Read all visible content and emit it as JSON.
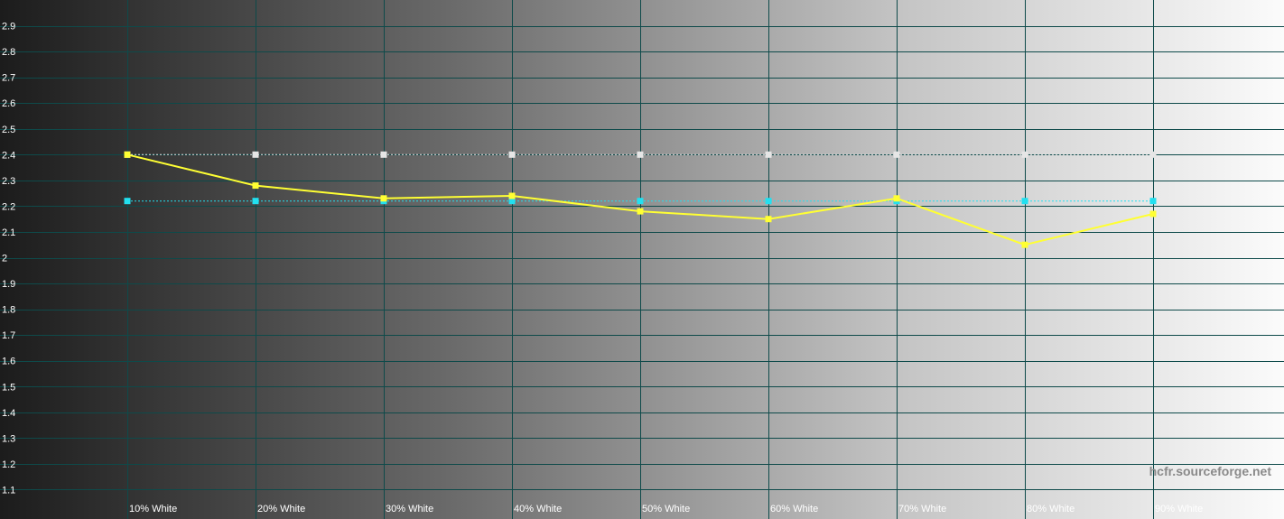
{
  "chart_data": {
    "type": "line",
    "categories": [
      "10% White",
      "20% White",
      "30% White",
      "40% White",
      "50% White",
      "60% White",
      "70% White",
      "80% White",
      "90% White"
    ],
    "ylim": [
      1.0,
      3.0
    ],
    "y_ticks": [
      "1.1",
      "1.2",
      "1.3",
      "1.4",
      "1.5",
      "1.6",
      "1.7",
      "1.8",
      "1.9",
      "2",
      "2.1",
      "2.2",
      "2.3",
      "2.4",
      "2.5",
      "2.6",
      "2.7",
      "2.8",
      "2.9"
    ],
    "grid": true,
    "series": [
      {
        "values": [
          2.4,
          2.28,
          2.23,
          2.24,
          2.18,
          2.15,
          2.23,
          2.05,
          2.17
        ],
        "color": "#ffff33",
        "style": "solid"
      },
      {
        "values": [
          2.4,
          2.4,
          2.4,
          2.4,
          2.4,
          2.4,
          2.4,
          2.4,
          2.4
        ],
        "color": "#e6e6e6",
        "style": "dashed"
      },
      {
        "values": [
          2.22,
          2.22,
          2.22,
          2.22,
          2.22,
          2.22,
          2.22,
          2.22,
          2.22
        ],
        "color": "#22e0f0",
        "style": "dashed"
      }
    ]
  },
  "watermark": "hcfr.sourceforge.net",
  "colors": {
    "grid": "#0e4a4a",
    "text": "#ffffff",
    "watermark": "#888888"
  }
}
